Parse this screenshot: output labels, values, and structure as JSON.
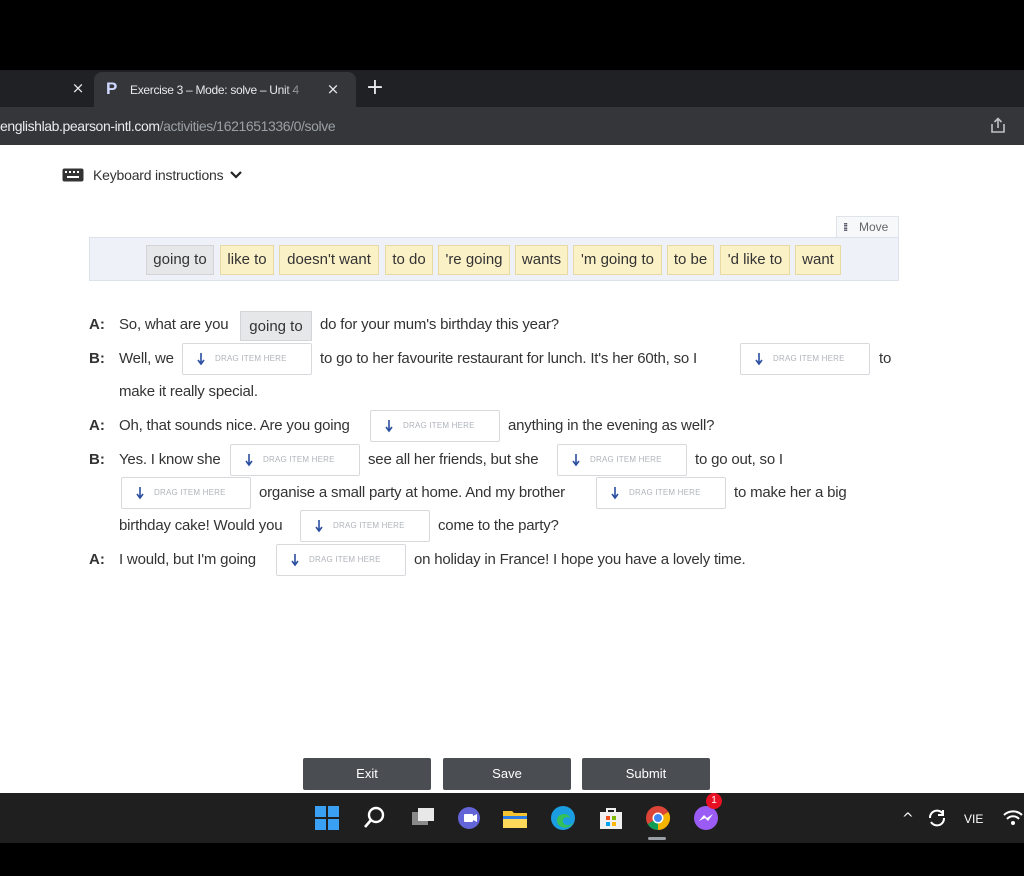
{
  "browser": {
    "prev_tab_close": "×",
    "tab": {
      "favicon": "P",
      "title": "Exercise 3 – Mode: solve – Unit 4",
      "close": "×"
    },
    "new_tab": "+",
    "url_host": "englishlab.pearson-intl.com",
    "url_path": "/activities/1621651336/0/solve"
  },
  "toolbar": {
    "keyboard_instructions": "Keyboard instructions",
    "move_label": "Move"
  },
  "word_bank": [
    "going to",
    "like to",
    "doesn't want",
    "to do",
    "'re going",
    "wants",
    "'m going to",
    "to be",
    "'d like to",
    "want"
  ],
  "drop_placeholder": "DRAG ITEM HERE",
  "dialogue": {
    "line1": {
      "speaker": "A:",
      "before": "So, what are you",
      "filled": "going to",
      "after": "do for your mum's birthday this year?"
    },
    "line2": {
      "speaker": "B:",
      "before": "Well, we",
      "mid": "to go to her favourite restaurant for lunch. It's her 60th, so I",
      "after": "to",
      "cont": "make it really special."
    },
    "line3": {
      "speaker": "A:",
      "before": "Oh, that sounds nice. Are you going",
      "after": "anything in the evening as well?"
    },
    "line4": {
      "speaker": "B:",
      "before": "Yes. I know she",
      "mid": "see all her friends, but she",
      "after": "to go out, so I",
      "cont1": "organise a small party at home. And my brother",
      "cont2": "to make her a big",
      "cont3": "birthday cake! Would you",
      "cont4": "come to the party?"
    },
    "line5": {
      "speaker": "A:",
      "before": "I would, but I'm going",
      "after": "on holiday in France! I hope you have a lovely time."
    }
  },
  "buttons": {
    "exit": "Exit",
    "save": "Save",
    "submit": "Submit"
  },
  "taskbar": {
    "messenger_badge": "1",
    "language": "VIE",
    "tray_chevron": "^"
  },
  "colors": {
    "chip_bg": "#fbf1c7",
    "used_chip_bg": "#e6e7e9",
    "button_bg": "#4a4d52",
    "browser_bg": "#202124"
  }
}
